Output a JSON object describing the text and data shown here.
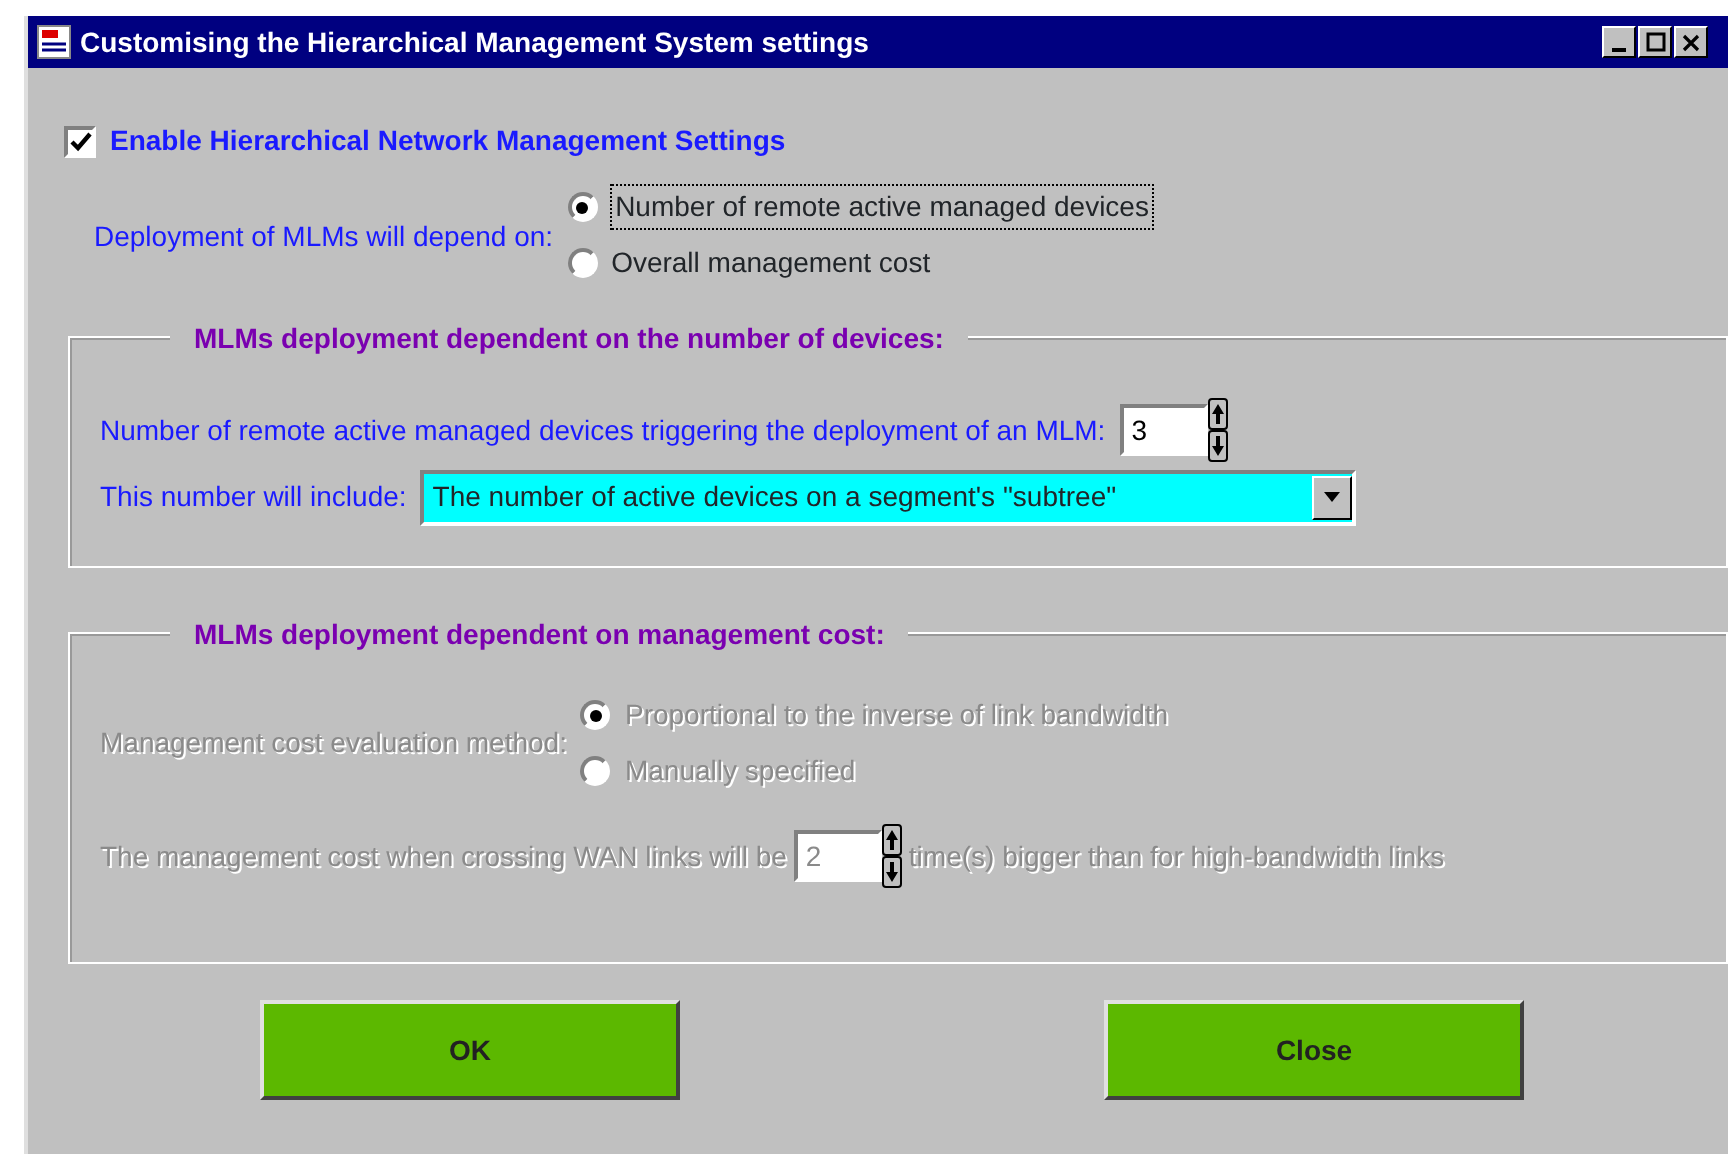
{
  "window": {
    "title": "Customising the Hierarchical Management System settings"
  },
  "enable": {
    "label": "Enable Hierarchical Network Management Settings",
    "checked": true
  },
  "deployment": {
    "label": "Deployment of MLMs will depend on:",
    "options": [
      {
        "label": "Number of remote active managed devices",
        "selected": true,
        "focused": true
      },
      {
        "label": "Overall management cost",
        "selected": false,
        "focused": false
      }
    ]
  },
  "devices_group": {
    "title": "MLMs deployment dependent on the number of devices:",
    "disabled": false,
    "trigger_label": "Number of remote active managed devices triggering the deployment of an MLM:",
    "trigger_value": "3",
    "include_label": "This number will include:",
    "include_value": "The number of active devices on a segment's \"subtree\""
  },
  "cost_group": {
    "title": "MLMs deployment dependent on management cost:",
    "disabled": true,
    "method_label": "Management cost evaluation method:",
    "options": [
      {
        "label": "Proportional to the inverse of link bandwidth",
        "selected": true
      },
      {
        "label": "Manually specified",
        "selected": false
      }
    ],
    "wan_label": "The management cost when crossing WAN links will be",
    "wan_value": "2",
    "wan_suffix": "time(s) bigger than for high-bandwidth links"
  },
  "buttons": [
    {
      "label": "OK"
    },
    {
      "label": "Close"
    }
  ]
}
